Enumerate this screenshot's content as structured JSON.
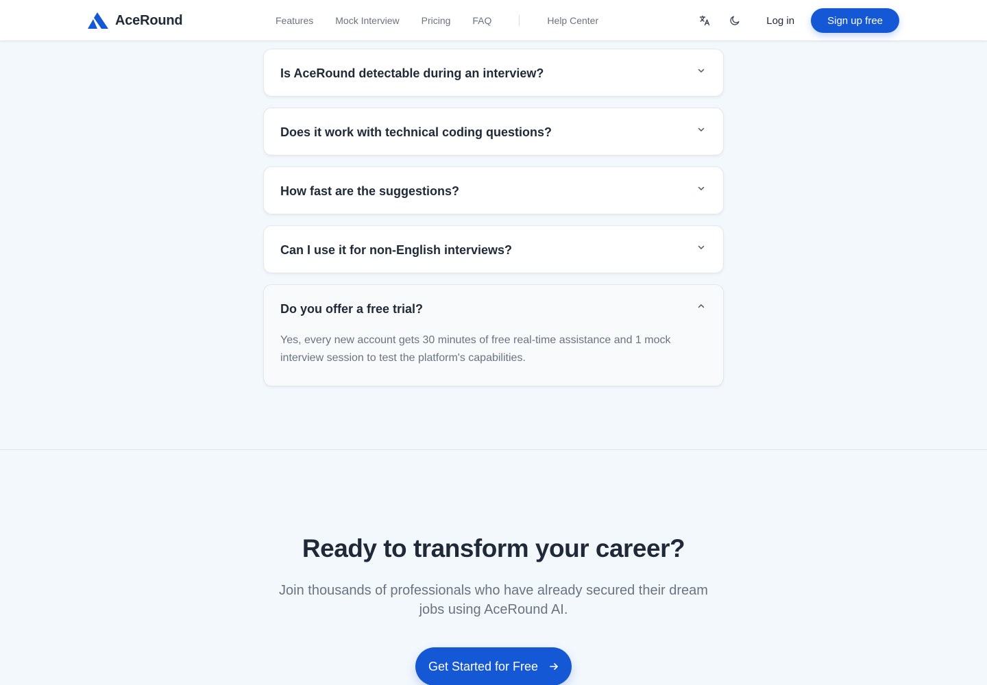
{
  "brand": {
    "name": "AceRound",
    "accent": "#1558d6",
    "logo_icon": "mountain-logo-icon"
  },
  "header": {
    "nav": [
      {
        "label": "Features"
      },
      {
        "label": "Mock Interview"
      },
      {
        "label": "Pricing"
      },
      {
        "label": "FAQ"
      }
    ],
    "help_center": "Help Center",
    "icons": [
      "translate-icon",
      "moon-icon"
    ],
    "login": "Log in",
    "signup": "Sign up free"
  },
  "faq": {
    "items": [
      {
        "question": "Is AceRound detectable during an interview?",
        "expanded": false,
        "icon": "chevron-down-icon"
      },
      {
        "question": "Does it work with technical coding questions?",
        "expanded": false,
        "icon": "chevron-down-icon"
      },
      {
        "question": "How fast are the suggestions?",
        "expanded": false,
        "icon": "chevron-down-icon"
      },
      {
        "question": "Can I use it for non-English interviews?",
        "expanded": false,
        "icon": "chevron-down-icon"
      },
      {
        "question": "Do you offer a free trial?",
        "expanded": true,
        "icon": "chevron-up-icon",
        "answer": "Yes, every new account gets 30 minutes of free real-time assistance and 1 mock interview session to test the platform's capabilities."
      }
    ]
  },
  "cta": {
    "title": "Ready to transform your career?",
    "subtitle": "Join thousands of professionals who have already secured their dream jobs using AceRound AI.",
    "button": "Get Started for Free",
    "button_icon": "arrow-right-icon"
  }
}
